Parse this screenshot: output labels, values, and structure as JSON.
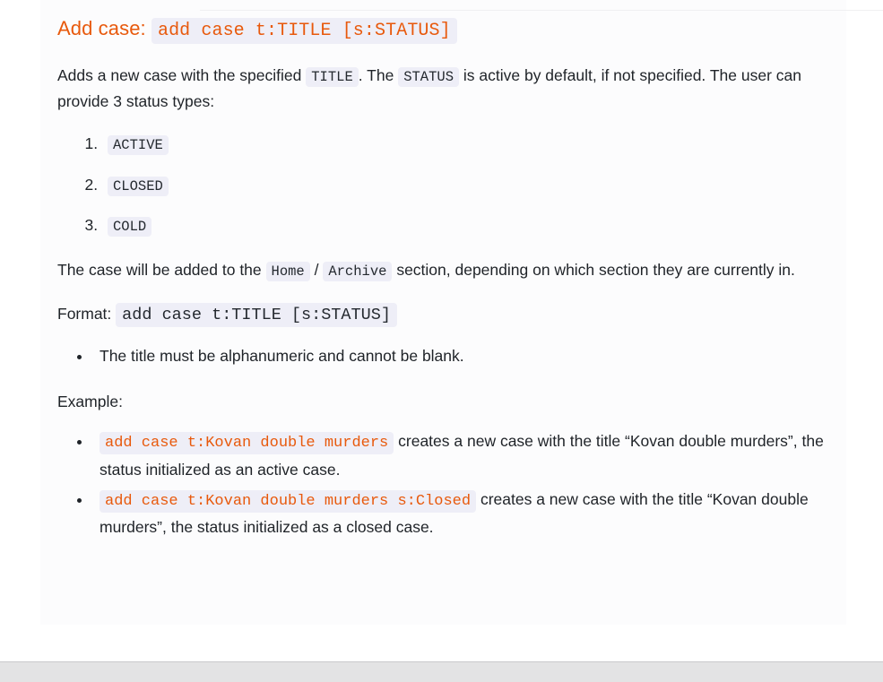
{
  "heading": {
    "label": "Add case:",
    "code": "add case t:TITLE [s:STATUS]"
  },
  "intro": {
    "part1": "Adds a new case with the specified ",
    "code_title": "TITLE",
    "part2": ". The ",
    "code_status": "STATUS",
    "part3": " is active by default, if not specified. The user can provide 3 status types:"
  },
  "status_types": [
    {
      "code": "ACTIVE"
    },
    {
      "code": "CLOSED"
    },
    {
      "code": "COLD"
    }
  ],
  "section_note": {
    "part1": "The case will be added to the ",
    "code_home": "Home",
    "separator": " / ",
    "code_archive": "Archive",
    "part2": " section, depending on which section they are currently in."
  },
  "format": {
    "label": "Format:",
    "code": "add case t:TITLE [s:STATUS]"
  },
  "constraints": [
    {
      "text": "The title must be alphanumeric and cannot be blank."
    }
  ],
  "example_label": "Example:",
  "examples": [
    {
      "code": "add case t:Kovan double murders",
      "text": " creates a new case with the title “Kovan double murders”, the status initialized as an active case."
    },
    {
      "code": "add case t:Kovan double murders s:Closed",
      "text": " creates a new case with the title “Kovan double murders”, the status initialized as a closed case."
    }
  ],
  "colors": {
    "accent": "#e8590c",
    "code_bg": "#eeeef7",
    "body_text": "#1f2328",
    "panel_bg": "#fcfcfd",
    "footer_bg": "#e3e3e4"
  }
}
